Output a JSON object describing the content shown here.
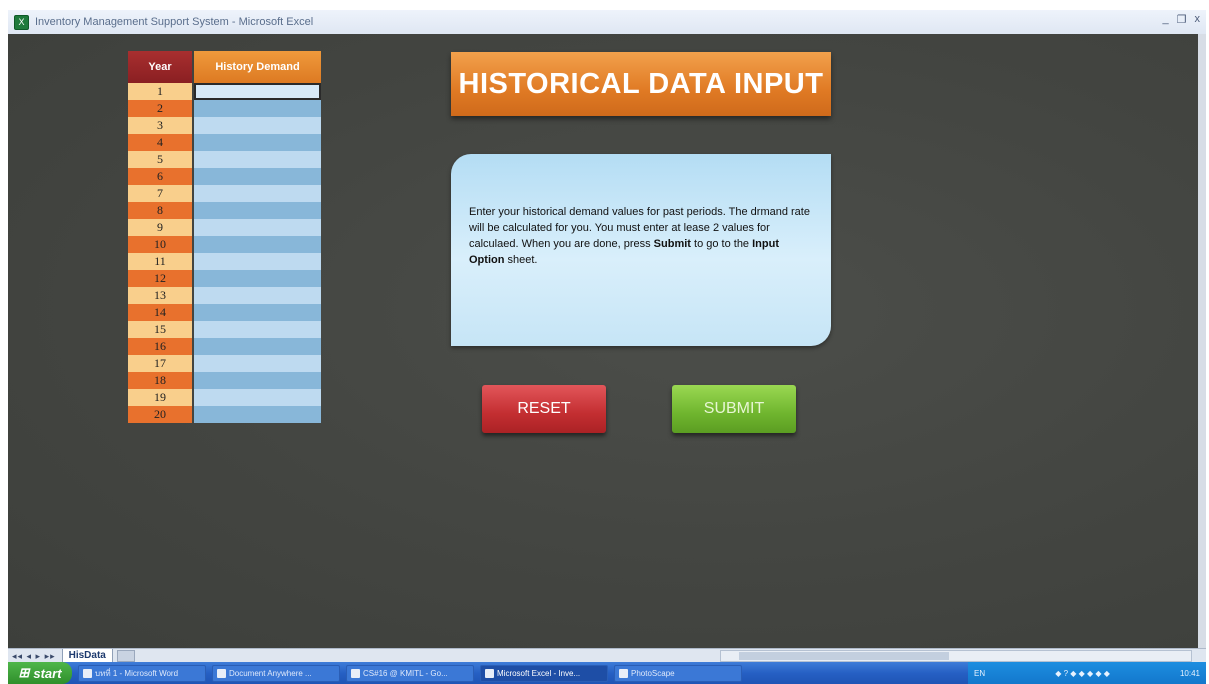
{
  "window": {
    "title": "Inventory Management Support System - Microsoft Excel",
    "controls": [
      "_",
      "❐",
      "x"
    ]
  },
  "table": {
    "year_header": "Year",
    "demand_header": "History Demand",
    "years": [
      "1",
      "2",
      "3",
      "4",
      "5",
      "6",
      "7",
      "8",
      "9",
      "10",
      "11",
      "12",
      "13",
      "14",
      "15",
      "16",
      "17",
      "18",
      "19",
      "20"
    ],
    "values": [
      "",
      "",
      "",
      "",
      "",
      "",
      "",
      "",
      "",
      "",
      "",
      "",
      "",
      "",
      "",
      "",
      "",
      "",
      "",
      ""
    ]
  },
  "banner": {
    "title": "HISTORICAL DATA INPUT"
  },
  "instructions": {
    "part1": "Enter your historical demand values for past periods. The drmand rate will be calculated for you. You must enter at lease 2 values for calculaed. When you are done, press ",
    "submit_word": "Submit",
    "part2": " to go to the ",
    "sheet_name": "Input Option",
    "part3": " sheet."
  },
  "buttons": {
    "reset": "RESET",
    "submit": "SUBMIT"
  },
  "sheet_tabs": {
    "nav": "◂◂ ◂ ▸ ▸▸",
    "active": "HisData"
  },
  "taskbar": {
    "start": "start",
    "items": [
      "บทที่ 1 - Microsoft Word",
      "Document Anywhere ...",
      "CS#16 @ KMITL - Go...",
      "Microsoft Excel - Inve...",
      "PhotoScape"
    ],
    "tray_lang": "EN",
    "clock": "10:41"
  },
  "colors": {
    "background": "#444642",
    "banner": "#e07a24",
    "reset": "#c32e31",
    "submit": "#6fb52e"
  }
}
